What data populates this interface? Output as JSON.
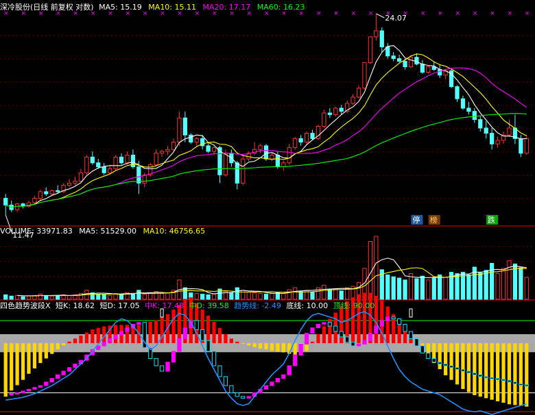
{
  "colors": {
    "background": "#000000",
    "up": "#ff3232",
    "down": "#54ffff",
    "ma5": "#ffffff",
    "ma10": "#ffff00",
    "ma20": "#ff00ff",
    "ma60": "#00ff00",
    "divider": "#c80000",
    "grid": "#7a0000",
    "trend": "#1e90ff",
    "band": "#a8a8a8",
    "bottom_line": "#ffffff",
    "top_line": "#00ff00"
  },
  "price_panel": {
    "title": "深冷股份(日线 前复权 对数)",
    "ma_labels": [
      {
        "name": "MA5",
        "text": "MA5: 15.19",
        "color": "#ffffff"
      },
      {
        "name": "MA10",
        "text": "MA10: 15.11",
        "color": "#ffff00"
      },
      {
        "name": "MA20",
        "text": "MA20: 17.17",
        "color": "#ff00ff"
      },
      {
        "name": "MA60",
        "text": "MA60: 16.23",
        "color": "#00ff00"
      }
    ],
    "high_label": "24.07",
    "low_label": "11.47",
    "markers": [
      {
        "text": "停",
        "index": 71,
        "bg": "#1e5aa0",
        "color": "#ffffff"
      },
      {
        "text": "榜",
        "index": 74,
        "bg": "#7a3a00",
        "color": "#ffcc66"
      },
      {
        "text": "跌",
        "index": 84,
        "bg": "#00aa00",
        "color": "#ffffff"
      }
    ]
  },
  "volume_panel": {
    "labels": [
      {
        "name": "volume",
        "text": "VOLUME: 33971.83",
        "color": "#ffffff"
      },
      {
        "name": "ma5",
        "text": "MA5: 51529.00",
        "color": "#ffffff"
      },
      {
        "name": "ma10",
        "text": "MA10: 46756.65",
        "color": "#ffff00"
      }
    ]
  },
  "indicator_panel": {
    "labels": [
      {
        "name": "title",
        "text": "四色趋势波段X",
        "color": "#ffffff"
      },
      {
        "name": "short-k",
        "text": "短K: 18.62",
        "color": "#ffffff"
      },
      {
        "name": "short-d",
        "text": "短D: 17.05",
        "color": "#ffffff"
      },
      {
        "name": "mid-k",
        "text": "中K: 17.48",
        "color": "#ff00ff"
      },
      {
        "name": "mid-d",
        "text": "中D: 39.58",
        "color": "#00ff00"
      },
      {
        "name": "trend-line",
        "text": "趋势线: -2.49",
        "color": "#1e90ff"
      },
      {
        "name": "bottom-line",
        "text": "底线: 10.00",
        "color": "#ffffff"
      },
      {
        "name": "top-line",
        "text": "顶线: 90.00",
        "color": "#00ff00"
      }
    ]
  },
  "chart_data": {
    "type": "candlestick",
    "title": "深冷股份(日线 前复权 对数)",
    "candles": [
      [
        12.2,
        12.4,
        11.47,
        11.9
      ],
      [
        11.9,
        12.1,
        11.6,
        11.7
      ],
      [
        11.7,
        12.0,
        11.6,
        11.95
      ],
      [
        11.95,
        12.0,
        11.75,
        11.85
      ],
      [
        11.85,
        12.1,
        11.8,
        12.0
      ],
      [
        12.0,
        12.3,
        11.95,
        12.2
      ],
      [
        12.2,
        12.6,
        12.1,
        12.5
      ],
      [
        12.5,
        12.7,
        12.3,
        12.4
      ],
      [
        12.4,
        12.6,
        12.3,
        12.55
      ],
      [
        12.55,
        12.8,
        12.4,
        12.5
      ],
      [
        12.5,
        12.9,
        12.45,
        12.8
      ],
      [
        12.8,
        13.1,
        12.7,
        12.9
      ],
      [
        12.9,
        13.2,
        12.8,
        13.0
      ],
      [
        13.0,
        13.6,
        12.9,
        13.4
      ],
      [
        13.4,
        14.3,
        13.3,
        14.2
      ],
      [
        14.2,
        14.5,
        13.8,
        13.9
      ],
      [
        13.9,
        14.1,
        13.6,
        13.7
      ],
      [
        13.7,
        13.9,
        13.3,
        13.4
      ],
      [
        13.4,
        13.8,
        13.3,
        13.6
      ],
      [
        13.6,
        14.3,
        13.5,
        14.2
      ],
      [
        14.2,
        14.4,
        13.8,
        13.9
      ],
      [
        13.9,
        14.5,
        13.8,
        14.3
      ],
      [
        14.3,
        14.6,
        13.6,
        13.7
      ],
      [
        13.7,
        14.0,
        12.4,
        12.9
      ],
      [
        12.9,
        13.4,
        12.7,
        13.3
      ],
      [
        13.3,
        13.9,
        13.2,
        13.8
      ],
      [
        13.8,
        14.6,
        13.7,
        14.4
      ],
      [
        14.4,
        14.6,
        14.2,
        14.5
      ],
      [
        14.5,
        14.8,
        14.3,
        14.6
      ],
      [
        14.6,
        15.2,
        14.5,
        15.0
      ],
      [
        15.0,
        16.8,
        14.8,
        16.4
      ],
      [
        16.4,
        16.8,
        15.0,
        15.4
      ],
      [
        15.4,
        15.5,
        14.9,
        15.0
      ],
      [
        15.0,
        15.3,
        14.8,
        15.2
      ],
      [
        15.2,
        15.4,
        14.6,
        14.8
      ],
      [
        14.8,
        15.0,
        14.4,
        14.5
      ],
      [
        14.5,
        14.8,
        14.3,
        14.7
      ],
      [
        14.7,
        14.8,
        12.9,
        13.3
      ],
      [
        13.3,
        14.6,
        13.2,
        14.4
      ],
      [
        14.4,
        14.6,
        13.7,
        13.9
      ],
      [
        13.9,
        14.0,
        12.6,
        12.9
      ],
      [
        12.9,
        14.3,
        12.8,
        14.1
      ],
      [
        14.1,
        14.5,
        14.0,
        14.4
      ],
      [
        14.4,
        15.0,
        14.3,
        14.6
      ],
      [
        14.6,
        14.9,
        14.4,
        14.8
      ],
      [
        14.8,
        14.9,
        14.0,
        14.1
      ],
      [
        14.1,
        14.4,
        14.0,
        14.3
      ],
      [
        14.3,
        14.5,
        13.6,
        13.7
      ],
      [
        13.7,
        14.0,
        13.5,
        13.9
      ],
      [
        13.9,
        14.9,
        13.8,
        14.7
      ],
      [
        14.7,
        15.3,
        14.6,
        15.2
      ],
      [
        15.2,
        15.4,
        14.8,
        15.0
      ],
      [
        15.0,
        15.6,
        14.9,
        15.5
      ],
      [
        15.5,
        15.7,
        15.1,
        15.2
      ],
      [
        15.2,
        16.0,
        15.1,
        15.9
      ],
      [
        15.9,
        16.9,
        15.8,
        16.7
      ],
      [
        16.7,
        17.0,
        16.4,
        16.6
      ],
      [
        16.6,
        17.1,
        16.5,
        17.0
      ],
      [
        17.0,
        17.2,
        16.6,
        16.8
      ],
      [
        16.8,
        17.5,
        16.7,
        17.3
      ],
      [
        17.3,
        17.9,
        17.2,
        17.7
      ],
      [
        17.7,
        18.5,
        17.6,
        18.3
      ],
      [
        18.3,
        20.1,
        18.2,
        20.1
      ],
      [
        20.1,
        22.1,
        20.0,
        22.1
      ],
      [
        22.1,
        24.07,
        21.8,
        22.6
      ],
      [
        22.6,
        22.9,
        20.9,
        21.3
      ],
      [
        21.3,
        21.6,
        20.4,
        20.6
      ],
      [
        20.6,
        20.9,
        20.2,
        20.4
      ],
      [
        20.4,
        20.7,
        20.1,
        20.2
      ],
      [
        20.2,
        20.4,
        19.6,
        19.8
      ],
      [
        19.8,
        20.7,
        19.7,
        20.5
      ],
      [
        20.5,
        20.8,
        19.9,
        20.0
      ],
      [
        20.0,
        20.3,
        19.3,
        19.4
      ],
      [
        19.4,
        19.9,
        19.3,
        19.8
      ],
      [
        19.8,
        20.2,
        19.5,
        19.6
      ],
      [
        19.6,
        20.0,
        19.0,
        19.2
      ],
      [
        19.2,
        19.6,
        18.9,
        19.5
      ],
      [
        19.5,
        19.7,
        18.3,
        18.4
      ],
      [
        18.4,
        18.5,
        17.4,
        17.6
      ],
      [
        17.6,
        17.8,
        16.9,
        17.0
      ],
      [
        17.0,
        17.4,
        16.6,
        16.8
      ],
      [
        16.8,
        17.0,
        16.1,
        16.3
      ],
      [
        16.3,
        16.5,
        15.6,
        15.8
      ],
      [
        15.8,
        16.2,
        15.2,
        15.5
      ],
      [
        15.5,
        15.8,
        14.6,
        14.9
      ],
      [
        14.9,
        15.3,
        14.7,
        15.1
      ],
      [
        15.1,
        15.6,
        14.9,
        15.4
      ],
      [
        15.4,
        16.3,
        15.3,
        15.8
      ],
      [
        15.8,
        16.6,
        14.9,
        15.2
      ],
      [
        15.2,
        15.4,
        14.2,
        14.4
      ],
      [
        14.4,
        15.4,
        14.3,
        15.2
      ]
    ],
    "volume": [
      7000,
      5000,
      6000,
      4000,
      5000,
      6000,
      8000,
      6000,
      5000,
      6000,
      7000,
      6000,
      7000,
      9000,
      14000,
      10000,
      8000,
      7000,
      6000,
      9000,
      8000,
      10000,
      9000,
      14000,
      8000,
      10000,
      12000,
      9000,
      10000,
      14000,
      30000,
      18000,
      10000,
      9000,
      8000,
      7000,
      8000,
      16000,
      12000,
      10000,
      18000,
      14000,
      11000,
      10000,
      9000,
      8000,
      9000,
      11000,
      9000,
      15000,
      18000,
      12000,
      14000,
      11000,
      18000,
      22000,
      15000,
      16000,
      13000,
      18000,
      20000,
      26000,
      48000,
      90000,
      98000,
      46000,
      38000,
      35000,
      33000,
      30000,
      40000,
      32000,
      36000,
      30000,
      33000,
      38000,
      34000,
      42000,
      40000,
      42000,
      38000,
      50000,
      41000,
      45000,
      56000,
      40000,
      48000,
      60000,
      55000,
      49000,
      33971.83
    ],
    "indicator": {
      "bottom_line": 10.0,
      "top_line": 90.0,
      "band": [
        55,
        75
      ],
      "mid_hist": [
        -70,
        -62,
        -55,
        -48,
        -40,
        -33,
        -26,
        -20,
        -14,
        -8,
        -3,
        2,
        6,
        10,
        14,
        18,
        20,
        22,
        23,
        24,
        24,
        24,
        24,
        24,
        26,
        28,
        30,
        34,
        38,
        44,
        50,
        58,
        60,
        52,
        44,
        36,
        28,
        20,
        12,
        6,
        2,
        -1,
        -3,
        -5,
        -7,
        -8,
        -10,
        -11,
        -12,
        -14,
        -15,
        -16,
        -10,
        2,
        12,
        22,
        32,
        40,
        48,
        55,
        60,
        64,
        66,
        66,
        62,
        56,
        48,
        38,
        28,
        18,
        8,
        -2,
        -10,
        -18,
        -26,
        -34,
        -42,
        -48,
        -54,
        -60,
        -64,
        -68,
        -70,
        -72,
        -74,
        -76,
        -78,
        -80,
        -81,
        -82,
        -83
      ],
      "short_k": [
        8,
        9,
        10,
        12,
        14,
        16,
        18,
        22,
        26,
        30,
        34,
        38,
        42,
        46,
        52,
        58,
        62,
        66,
        70,
        74,
        78,
        82,
        86,
        88,
        60,
        48,
        40,
        34,
        44,
        56,
        70,
        82,
        90,
        80,
        68,
        56,
        40,
        28,
        18,
        10,
        6,
        4,
        6,
        10,
        14,
        18,
        22,
        26,
        30,
        40,
        52,
        64,
        76,
        82,
        86,
        88,
        84,
        78,
        72,
        66,
        62,
        64,
        68,
        76,
        84,
        90,
        94,
        92,
        86,
        78,
        70,
        62,
        54,
        48,
        44,
        42,
        40,
        38,
        36,
        34,
        32,
        30,
        28,
        27,
        26,
        25,
        24,
        22,
        20,
        19,
        18.62
      ],
      "trend": [
        2,
        3,
        4,
        5,
        7,
        9,
        12,
        15,
        18,
        22,
        26,
        30,
        36,
        42,
        48,
        56,
        64,
        72,
        80,
        88,
        92,
        90,
        84,
        76,
        66,
        58,
        62,
        72,
        82,
        92,
        98,
        96,
        88,
        76,
        62,
        48,
        36,
        24,
        12,
        4,
        -2,
        -4,
        -2,
        6,
        14,
        22,
        30,
        36,
        42,
        54,
        68,
        80,
        90,
        96,
        98,
        96,
        94,
        92,
        88,
        90,
        94,
        98,
        100,
        96,
        88,
        76,
        62,
        48,
        36,
        28,
        22,
        18,
        14,
        12,
        10,
        8,
        4,
        0,
        -4,
        -8,
        -10,
        -11,
        -10,
        -12,
        -14,
        -12,
        -10,
        -8,
        -6,
        -4,
        -2.49
      ],
      "signal_marks": [
        27,
        70,
        107
      ]
    }
  }
}
